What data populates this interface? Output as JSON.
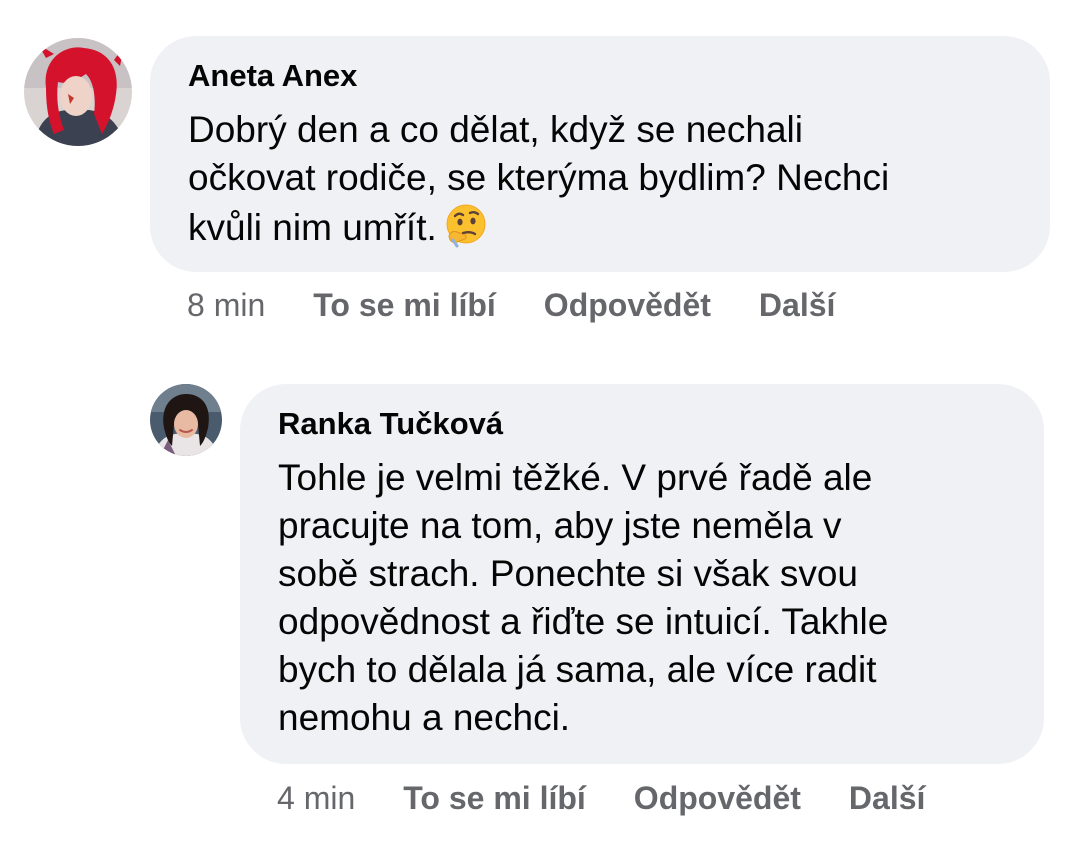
{
  "comments": [
    {
      "author": "Aneta Anex",
      "text_lines": [
        "Dobrý den a co dělat, když se nechali",
        "očkovat rodiče, se kterýma bydlim? Nechci",
        "kvůli nim umřít."
      ],
      "emoji": "thinking-face",
      "time": "8 min",
      "actions": {
        "like": "To se mi líbí",
        "reply": "Odpovědět",
        "more": "Další"
      }
    },
    {
      "author": "Ranka Tučková",
      "text_lines": [
        "Tohle je velmi těžké. V prvé řadě ale",
        "pracujte na tom, aby jste neměla v",
        "sobě strach. Ponechte si však svou",
        "odpovědnost a řiďte se intuicí. Takhle",
        "bych to dělala já sama, ale více radit",
        "nemohu a nechci."
      ],
      "time": "4 min",
      "actions": {
        "like": "To se mi líbí",
        "reply": "Odpovědět",
        "more": "Další"
      }
    }
  ],
  "colors": {
    "bubble": "#eff1f4",
    "text": "#050505",
    "meta": "#65676b"
  }
}
